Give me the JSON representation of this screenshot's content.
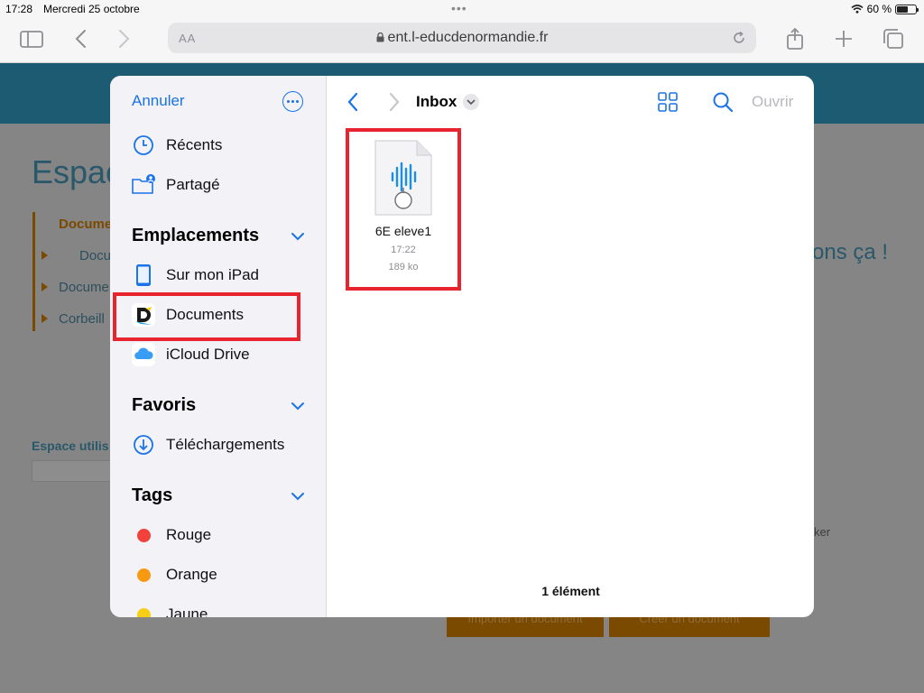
{
  "status_bar": {
    "time": "17:28",
    "date": "Mercredi 25 octobre",
    "battery": "60 %",
    "battery_level": 0.6
  },
  "browser": {
    "text_size_label": "AA",
    "url": "ent.l-educdenormandie.fr",
    "icons": [
      "sidebar-icon",
      "back-icon",
      "forward-icon",
      "lock-icon",
      "reload-icon",
      "share-icon",
      "plus-icon",
      "tabs-icon"
    ]
  },
  "background_page": {
    "title": "Espac",
    "links": [
      "Docume",
      "Docu",
      "Docume",
      "Corbeill"
    ],
    "right_text": "ons ça !",
    "space_label": "Espace utilis",
    "small_text": "ker",
    "buttons": [
      "Importer un document",
      "Créer un document"
    ],
    "colors": {
      "header": "#1d5b72",
      "accent": "#7a4a00"
    }
  },
  "picker": {
    "cancel_label": "Annuler",
    "recents_label": "Récents",
    "shared_label": "Partagé",
    "locations_header": "Emplacements",
    "locations": [
      {
        "label": "Sur mon iPad",
        "icon": "ipad-icon"
      },
      {
        "label": "Documents",
        "icon": "documents-app-icon"
      },
      {
        "label": "iCloud Drive",
        "icon": "icloud-icon"
      }
    ],
    "favorites_header": "Favoris",
    "favorites": [
      {
        "label": "Téléchargements",
        "icon": "download-icon"
      }
    ],
    "tags_header": "Tags",
    "tags": [
      {
        "label": "Rouge",
        "color": "#f2403a"
      },
      {
        "label": "Orange",
        "color": "#f79a12"
      },
      {
        "label": "Jaune",
        "color": "#f7ce13"
      }
    ],
    "folder_title": "Inbox",
    "open_label": "Ouvrir",
    "files": [
      {
        "name": "6E eleve1",
        "time": "17:22",
        "size": "189 ko",
        "icon": "audio-file-icon"
      }
    ],
    "item_count": "1 élément",
    "colors": {
      "accent": "#1a73e8",
      "highlight": "#e8242e"
    }
  }
}
